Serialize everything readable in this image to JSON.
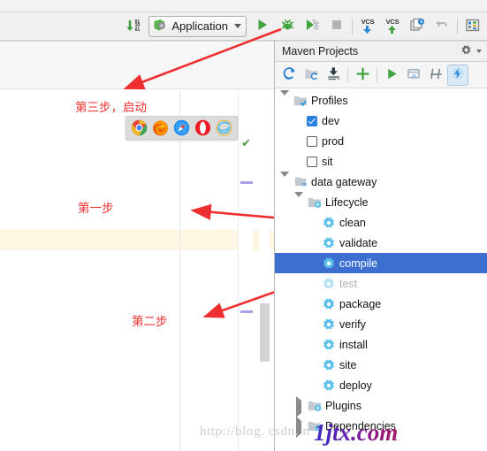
{
  "toolbar": {
    "binary_icon": "download-binary-icon",
    "run_config_label": "Application",
    "run_label": "run-icon",
    "debug_label": "debug-icon",
    "coverage_label": "run-with-coverage-icon",
    "stop_label": "stop-icon",
    "vcs_update_text": "VCS",
    "vcs_commit_text": "VCS",
    "history_label": "vcs-history-icon",
    "undo_label": "undo-icon",
    "settings_label": "project-structure-icon"
  },
  "maven": {
    "title": "Maven Projects",
    "settings_icon": "gear-icon",
    "toolbar_buttons": [
      {
        "name": "reimport-icon"
      },
      {
        "name": "generate-sources-icon"
      },
      {
        "name": "download-sources-icon"
      },
      {
        "name": "add-maven-project-icon"
      },
      {
        "name": "run-maven-build-icon"
      },
      {
        "name": "execute-goal-icon"
      },
      {
        "name": "toggle-skip-tests-icon"
      },
      {
        "name": "toggle-offline-icon"
      }
    ],
    "tree": [
      {
        "label": "Profiles",
        "indent": 0,
        "twisty": "down",
        "icon": "profiles-folder-icon",
        "checkbox": null,
        "state": "normal"
      },
      {
        "label": "dev",
        "indent": 1,
        "twisty": "none",
        "icon": null,
        "checkbox": true,
        "state": "normal"
      },
      {
        "label": "prod",
        "indent": 1,
        "twisty": "none",
        "icon": null,
        "checkbox": false,
        "state": "normal"
      },
      {
        "label": "sit",
        "indent": 1,
        "twisty": "none",
        "icon": null,
        "checkbox": false,
        "state": "normal"
      },
      {
        "label": "data gateway",
        "indent": 0,
        "twisty": "down",
        "icon": "maven-module-icon",
        "checkbox": null,
        "state": "normal"
      },
      {
        "label": "Lifecycle",
        "indent": 1,
        "twisty": "down",
        "icon": "lifecycle-folder-icon",
        "checkbox": null,
        "state": "normal"
      },
      {
        "label": "clean",
        "indent": 2,
        "twisty": "none",
        "icon": "goal-gear-icon",
        "checkbox": null,
        "state": "normal"
      },
      {
        "label": "validate",
        "indent": 2,
        "twisty": "none",
        "icon": "goal-gear-icon",
        "checkbox": null,
        "state": "normal"
      },
      {
        "label": "compile",
        "indent": 2,
        "twisty": "none",
        "icon": "goal-gear-icon",
        "checkbox": null,
        "state": "selected"
      },
      {
        "label": "test",
        "indent": 2,
        "twisty": "none",
        "icon": "goal-gear-icon",
        "checkbox": null,
        "state": "dimmed"
      },
      {
        "label": "package",
        "indent": 2,
        "twisty": "none",
        "icon": "goal-gear-icon",
        "checkbox": null,
        "state": "normal"
      },
      {
        "label": "verify",
        "indent": 2,
        "twisty": "none",
        "icon": "goal-gear-icon",
        "checkbox": null,
        "state": "normal"
      },
      {
        "label": "install",
        "indent": 2,
        "twisty": "none",
        "icon": "goal-gear-icon",
        "checkbox": null,
        "state": "normal"
      },
      {
        "label": "site",
        "indent": 2,
        "twisty": "none",
        "icon": "goal-gear-icon",
        "checkbox": null,
        "state": "normal"
      },
      {
        "label": "deploy",
        "indent": 2,
        "twisty": "none",
        "icon": "goal-gear-icon",
        "checkbox": null,
        "state": "normal"
      },
      {
        "label": "Plugins",
        "indent": 1,
        "twisty": "right",
        "icon": "plugins-folder-icon",
        "checkbox": null,
        "state": "normal"
      },
      {
        "label": "Dependencies",
        "indent": 1,
        "twisty": "right",
        "icon": "dependencies-folder-icon",
        "checkbox": null,
        "state": "normal"
      }
    ]
  },
  "browser_popup": {
    "browsers": [
      {
        "name": "chrome-icon"
      },
      {
        "name": "firefox-icon"
      },
      {
        "name": "safari-icon"
      },
      {
        "name": "opera-icon"
      },
      {
        "name": "internet-explorer-icon"
      }
    ]
  },
  "annotations": {
    "step_one": "第一步",
    "step_two": "第二步",
    "step_three": "第三步，启动",
    "color": "#EF2F2F"
  },
  "watermark": {
    "url": "http://blog. csdn. n",
    "brand": "1jtx.com"
  },
  "colors": {
    "selection_blue": "#3C6FD0",
    "caret_line": "#FDF6E3",
    "accent_green": "#3FA33F",
    "annotation_red": "#EF2F2F"
  }
}
